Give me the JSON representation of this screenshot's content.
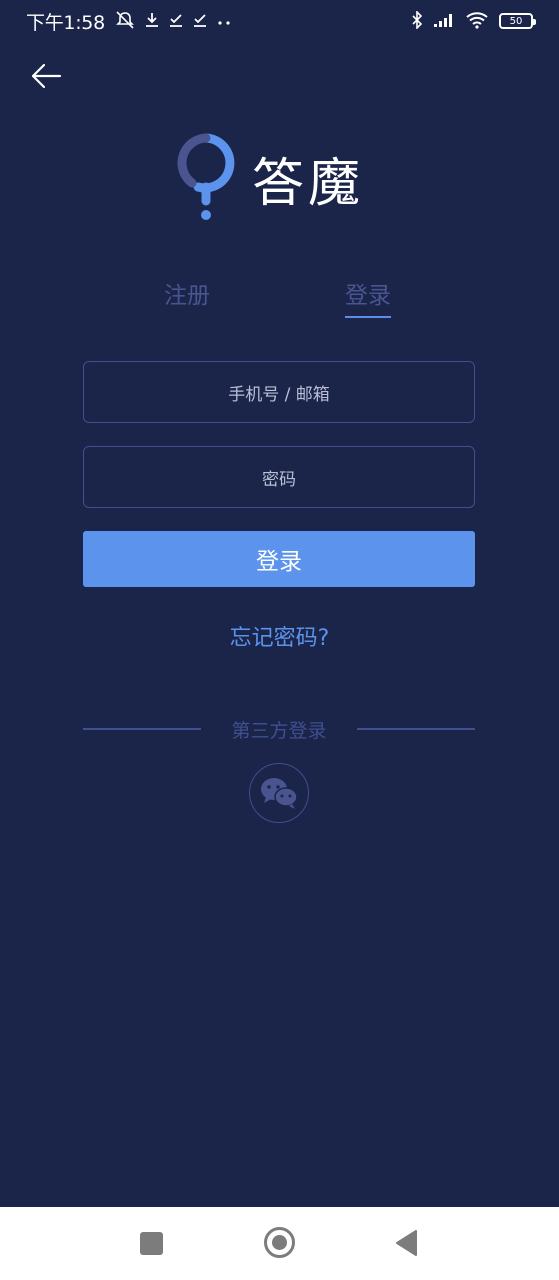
{
  "status_bar": {
    "time": "下午1:58",
    "battery": "50"
  },
  "logo": {
    "text": "答魔"
  },
  "tabs": [
    {
      "label": "注册",
      "active": false
    },
    {
      "label": "登录",
      "active": true
    }
  ],
  "form": {
    "account_placeholder": "手机号 / 邮箱",
    "password_placeholder": "密码",
    "submit_label": "登录",
    "forgot_label": "忘记密码?"
  },
  "third_party": {
    "label": "第三方登录",
    "provider_icon": "wechat-icon"
  },
  "colors": {
    "background": "#1b2449",
    "accent": "#5b93ed",
    "muted": "#3f4f8f",
    "nav_bar": "#ffffff"
  }
}
